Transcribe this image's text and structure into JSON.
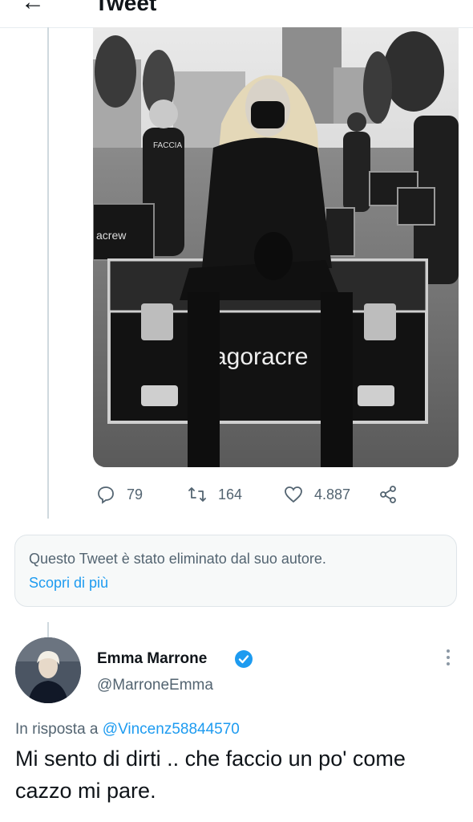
{
  "header": {
    "title": "Tweet"
  },
  "tweet": {
    "photo_text": "agoracre",
    "photo_text_small": "acrew",
    "photo_text_jacket": "FACCIA",
    "actions": {
      "replies": "79",
      "retweets": "164",
      "likes": "4.887"
    }
  },
  "deleted_notice": {
    "text": "Questo Tweet è stato eliminato dal suo autore.",
    "link": "Scopri di più"
  },
  "main_tweet": {
    "author_name": "Emma Marrone",
    "author_handle": "@MarroneEmma",
    "reply_prefix": "In risposta a",
    "reply_handle": "@Vincenz58844570",
    "text": "Mi sento di dirti .. che faccio un po' come cazzo mi pare."
  },
  "colors": {
    "accent": "#1d9bf0",
    "secondary_text": "#536471",
    "primary_text": "#0f1419"
  }
}
